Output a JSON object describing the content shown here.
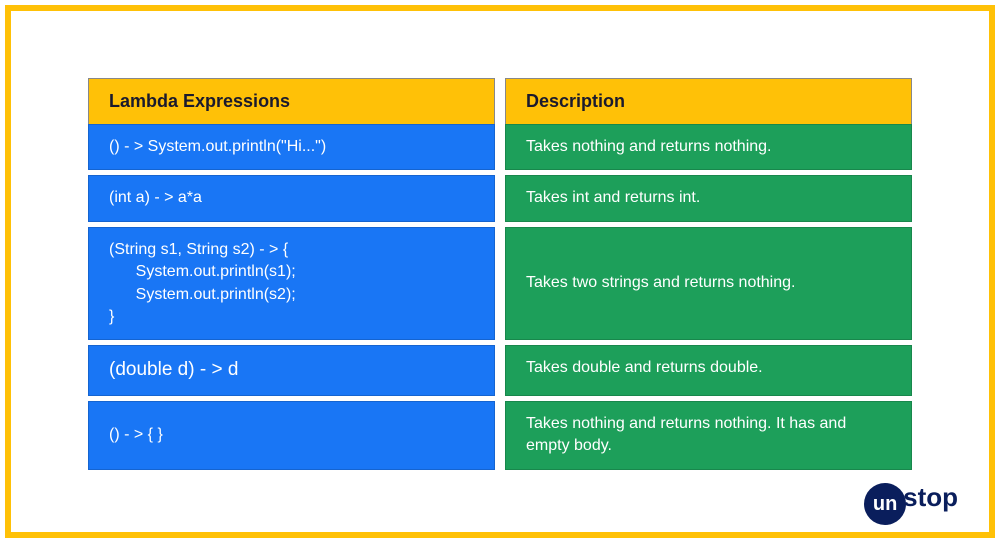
{
  "headers": {
    "left": "Lambda Expressions",
    "right": "Description"
  },
  "rows": [
    {
      "lambda": "() - > System.out.println(\"Hi...\")",
      "description": "Takes nothing and returns nothing."
    },
    {
      "lambda": "(int a) - > a*a",
      "description": "Takes int and returns int."
    },
    {
      "lambda": "(String s1, String s2) - > {\n      System.out.println(s1);\n      System.out.println(s2);\n}",
      "description": "Takes two strings and returns nothing."
    },
    {
      "lambda": "(double d) - > d",
      "description": "Takes double and returns double."
    },
    {
      "lambda": "() - > { }",
      "description": "Takes nothing and returns nothing. It has and empty body."
    }
  ],
  "logo": {
    "part1": "un",
    "part2": "stop"
  },
  "chart_data": {
    "type": "table",
    "columns": [
      "Lambda Expressions",
      "Description"
    ],
    "rows": [
      [
        "() - > System.out.println(\"Hi...\")",
        "Takes nothing and returns nothing."
      ],
      [
        "(int a) - > a*a",
        "Takes int and returns int."
      ],
      [
        "(String s1, String s2) - > { System.out.println(s1); System.out.println(s2); }",
        "Takes two strings and returns nothing."
      ],
      [
        "(double d) - > d",
        "Takes double and returns double."
      ],
      [
        "() - > { }",
        "Takes nothing and returns nothing. It has and empty body."
      ]
    ]
  }
}
